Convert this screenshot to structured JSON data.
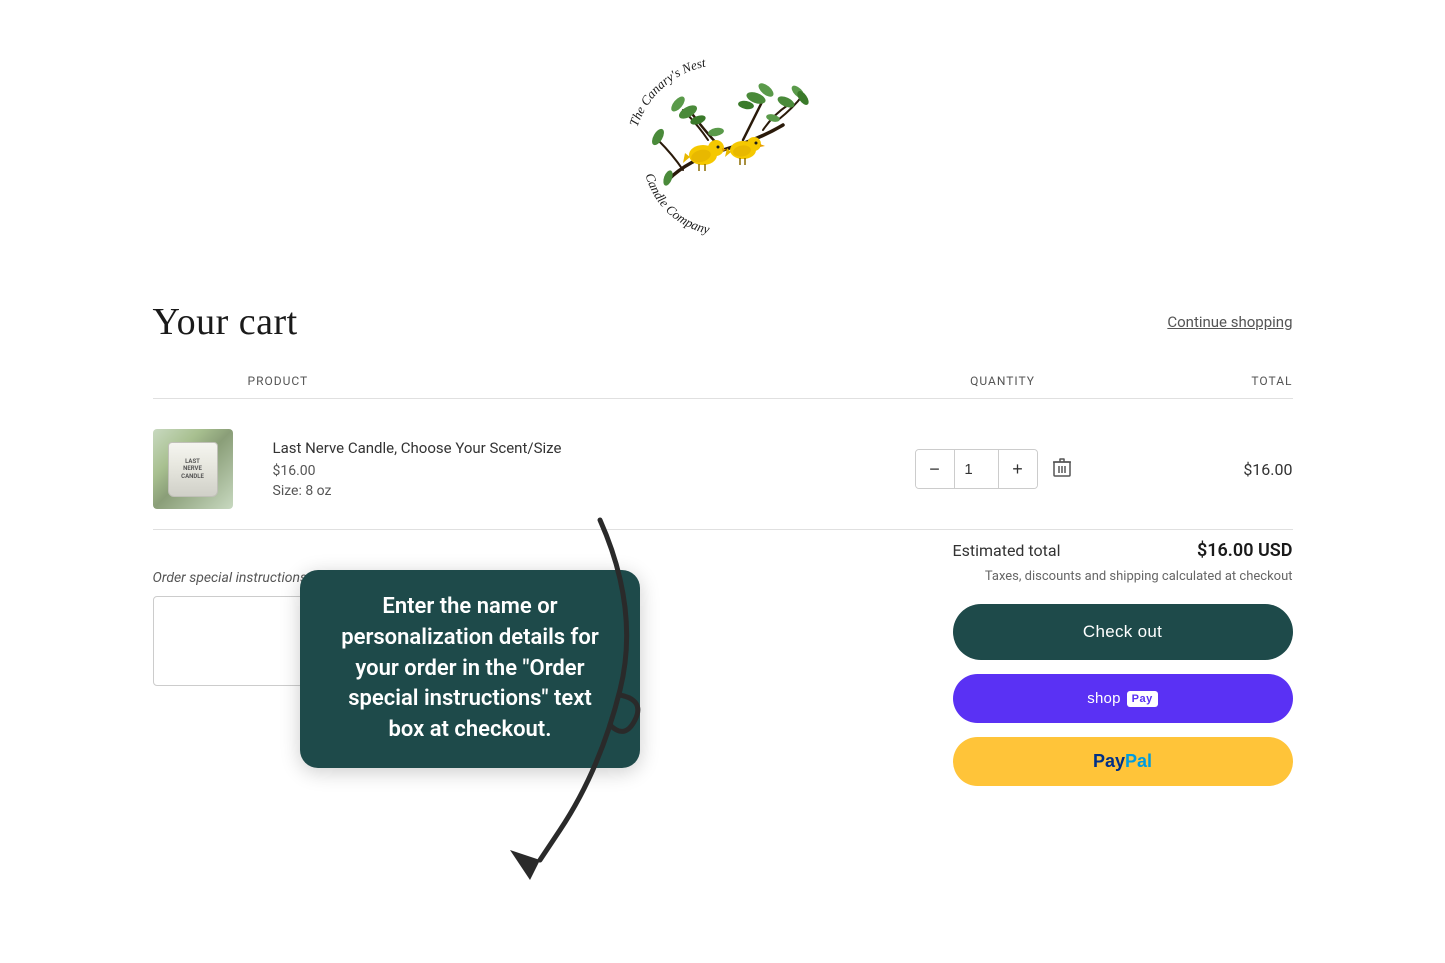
{
  "brand": {
    "name": "The Canary's Nest Candle Company"
  },
  "header": {
    "continue_shopping": "Continue shopping"
  },
  "cart": {
    "title": "Your cart",
    "columns": {
      "product": "PRODUCT",
      "quantity": "QUANTITY",
      "total": "TOTAL"
    },
    "items": [
      {
        "id": "item-1",
        "name": "Last Nerve Candle, Choose Your Scent/Size",
        "price": "$16.00",
        "size_label": "Size: 8 oz",
        "quantity": 1,
        "total": "$16.00"
      }
    ],
    "instructions_label": "Order special instructions",
    "instructions_placeholder": ""
  },
  "summary": {
    "estimated_total_label": "Estimated total",
    "estimated_total_amount": "$16.00 USD",
    "tax_note": "Taxes, discounts and shipping calculated at checkout",
    "checkout_label": "Check out",
    "shop_pay_label": "shop",
    "shop_pay_badge": "Pay",
    "paypal_label": "PayPal"
  },
  "callout": {
    "text": "Enter the name or personalization details for your order in the \"Order special instructions\" text box at checkout."
  }
}
